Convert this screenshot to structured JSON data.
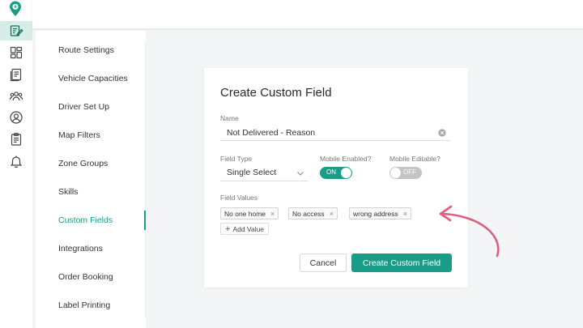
{
  "colors": {
    "accent": "#1a9c88",
    "rail_active_bg": "#d6ede8",
    "annotation_arrow": "#dd5f79"
  },
  "rail": {
    "icons": [
      "route-pin-logo",
      "edit-form-icon",
      "dashboard-grid-icon",
      "documents-icon",
      "team-users-icon",
      "user-circle-icon",
      "clipboard-icon",
      "bell-icon"
    ],
    "active": "edit-form-icon"
  },
  "settings_nav": {
    "items": [
      {
        "label": "Route Settings"
      },
      {
        "label": "Vehicle Capacities"
      },
      {
        "label": "Driver Set Up"
      },
      {
        "label": "Map Filters"
      },
      {
        "label": "Zone Groups"
      },
      {
        "label": "Skills"
      },
      {
        "label": "Custom Fields"
      },
      {
        "label": "Integrations"
      },
      {
        "label": "Order Booking"
      },
      {
        "label": "Label Printing"
      }
    ],
    "active": "Custom Fields"
  },
  "form": {
    "title": "Create Custom Field",
    "name_label": "Name",
    "name_value": "Not Delivered - Reason",
    "field_type_label": "Field Type",
    "field_type_value": "Single Select",
    "mobile_enabled_label": "Mobile Enabled?",
    "mobile_enabled_state": "ON",
    "mobile_editable_label": "Mobile Editable?",
    "mobile_editable_state": "OFF",
    "field_values_label": "Field Values",
    "field_values": [
      "No one home",
      "No access",
      "wrong address"
    ],
    "chip_remove_glyph": "×",
    "add_value_label": "Add Value",
    "cancel_label": "Cancel",
    "create_label": "Create Custom Field"
  }
}
